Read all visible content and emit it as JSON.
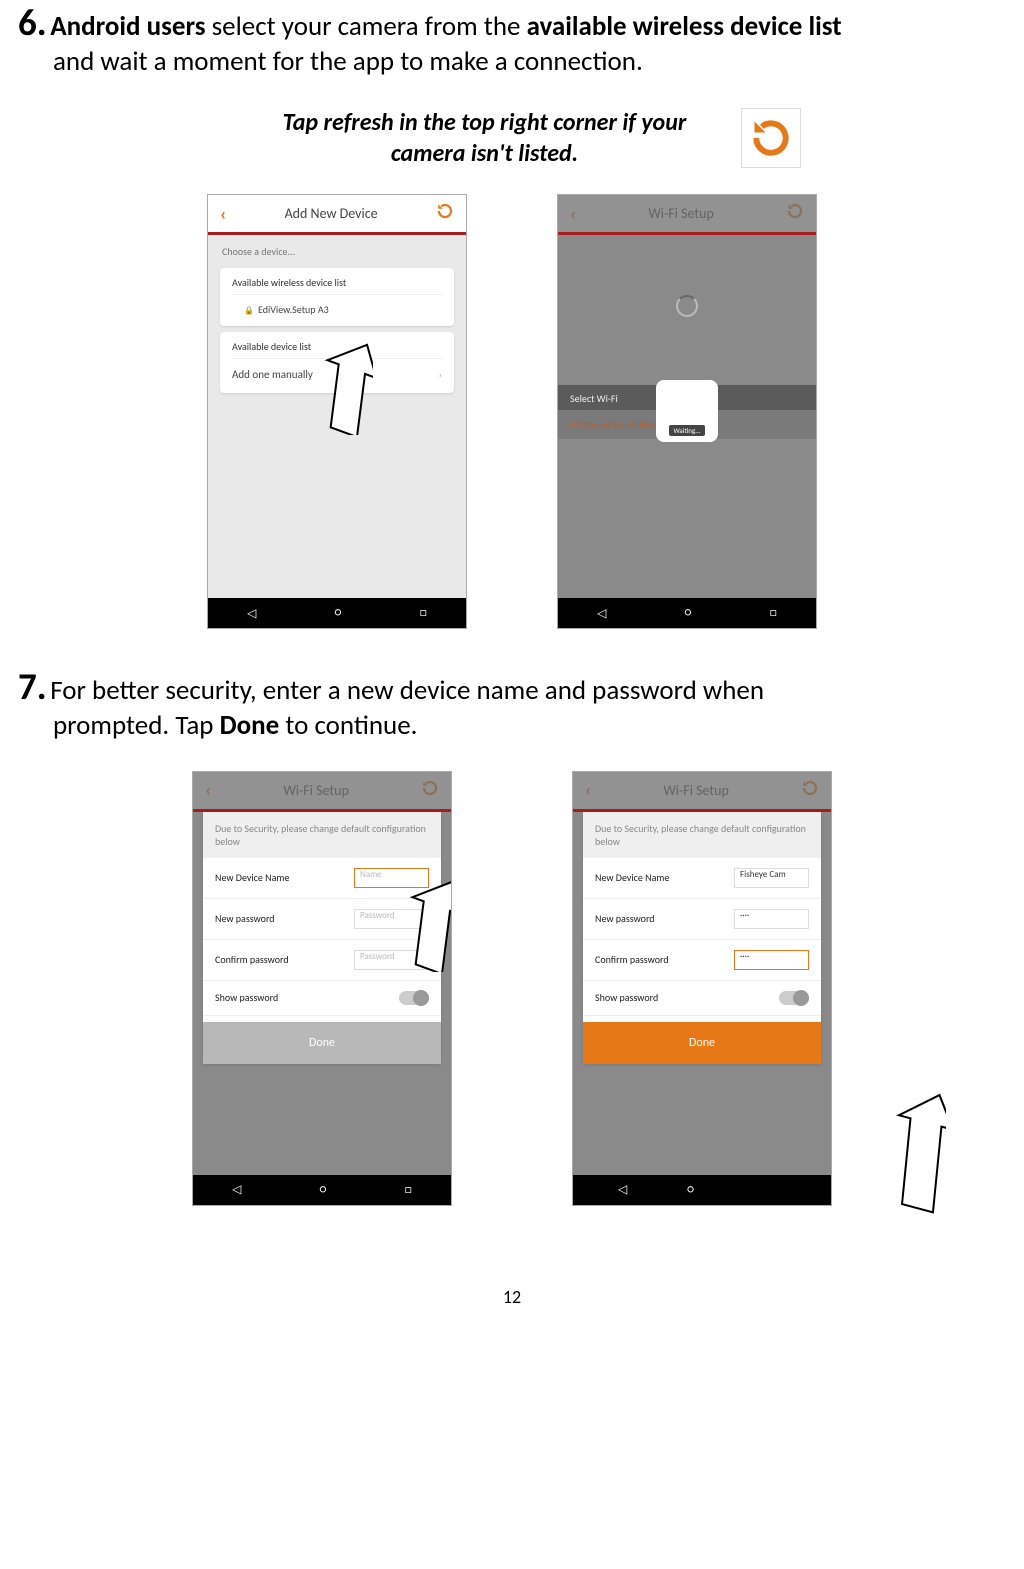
{
  "step6": {
    "num": "6.",
    "text1_pre": " Android users ",
    "text1_mid": "select your camera from the ",
    "text1_bold2": "available wireless device list",
    "text2": "and wait a moment for the app to make a connection."
  },
  "hint": {
    "line1": "Tap refresh in the top right corner if your",
    "line2": "camera  isn't listed."
  },
  "screen_add": {
    "title": "Add New Device",
    "choose": "Choose a device...",
    "card1_title": "Available wireless device list",
    "card1_item": "EdiView.Setup A3",
    "card2_title": "Available device list",
    "card2_item": "Add one manually"
  },
  "screen_wifi_wait": {
    "title": "Wi-Fi Setup",
    "select": "Select Wi-Fi",
    "hidden_net": "+ Connect to a hidden network",
    "waiting": "Waiting..."
  },
  "step7": {
    "num": "7.",
    "text1": " For better security, enter a new device name and password when",
    "text2_pre": "prompted. Tap ",
    "text2_bold": "Done",
    "text2_post": " to continue."
  },
  "screen_form": {
    "title": "Wi-Fi Setup",
    "instr": "Due to Security, please change default configuration below",
    "row1": "New Device Name",
    "row2": "New password",
    "row3": "Confirm password",
    "row4": "Show password",
    "ph_name": "Name",
    "ph_pass": "Password",
    "val_name": "Fisheye Cam",
    "val_pass": "····",
    "done": "Done"
  },
  "nav": {
    "back": "◁",
    "home": "○",
    "recent": "□"
  },
  "page": "12"
}
